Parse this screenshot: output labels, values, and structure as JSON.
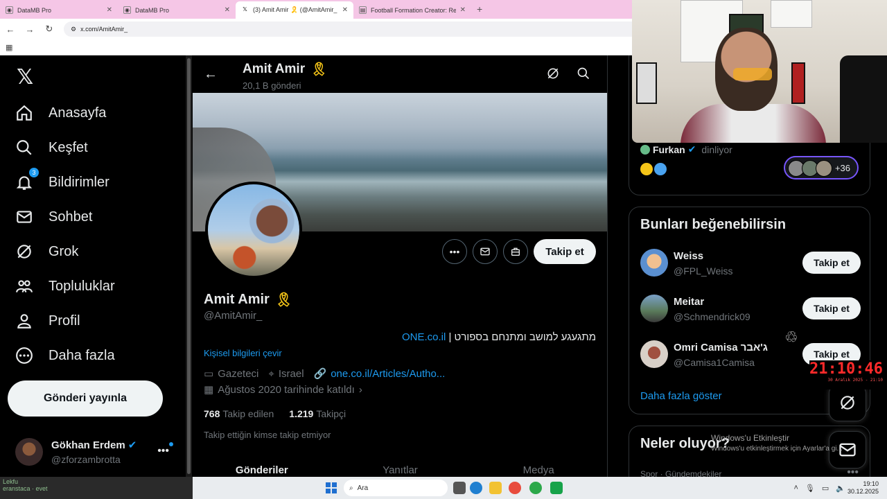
{
  "browser": {
    "tabs": [
      {
        "title": "DataMB Pro",
        "icon": "datamb-icon"
      },
      {
        "title": "DataMB Pro",
        "icon": "datamb-icon"
      },
      {
        "title": "(3) Amit Amir 🎗️ (@AmitAmir_",
        "icon": "x-icon"
      },
      {
        "title": "Football Formation Creator: Re",
        "icon": "doc-icon"
      }
    ],
    "url": "x.com/AmitAmir_"
  },
  "nav": {
    "items": [
      {
        "label": "Anasayfa",
        "icon": "home-icon"
      },
      {
        "label": "Keşfet",
        "icon": "search-icon"
      },
      {
        "label": "Bildirimler",
        "icon": "bell-icon",
        "badge": "3"
      },
      {
        "label": "Sohbet",
        "icon": "mail-icon"
      },
      {
        "label": "Grok",
        "icon": "grok-icon"
      },
      {
        "label": "Topluluklar",
        "icon": "communities-icon"
      },
      {
        "label": "Profil",
        "icon": "profile-icon"
      },
      {
        "label": "Daha fazla",
        "icon": "more-icon"
      }
    ],
    "post_button": "Gönderi yayınla",
    "me": {
      "name": "Gökhan Erdem",
      "handle": "@zforzambrotta"
    }
  },
  "profile": {
    "header_name": "Amit Amir",
    "header_posts": "20,1 B gönderi",
    "name": "Amit Amir",
    "handle": "@AmitAmir_",
    "bio_text": "מתגעגע למושב ומתנחם בספורט |",
    "bio_link": "ONE.co.il",
    "translate": "Kişisel bilgileri çevir",
    "job": "Gazeteci",
    "location": "Israel",
    "website": "one.co.il/Articles/Autho...",
    "joined": "Ağustos 2020 tarihinde katıldı",
    "following_count": "768",
    "following_label": "Takip edilen",
    "followers_count": "1.219",
    "followers_label": "Takipçi",
    "no_mutual": "Takip ettiğin kimse takip etmiyor",
    "follow_button": "Takip et",
    "tabs": [
      "Gönderiler",
      "Yanıtlar",
      "Medya"
    ]
  },
  "space": {
    "listener": "Furkan",
    "listening": "dinliyor",
    "count": "+36"
  },
  "suggest": {
    "title": "Bunları beğenebilirsin",
    "users": [
      {
        "name": "Weiss",
        "handle": "@FPL_Weiss",
        "button": "Takip et"
      },
      {
        "name": "Meitar",
        "handle": "@Schmendrick09",
        "button": "Takip et"
      },
      {
        "name": "Omri Camisa ג'אבר",
        "handle": "@Camisa1Camisa",
        "button": "Takip et"
      }
    ],
    "show_more": "Daha fazla göster"
  },
  "trends": {
    "title": "Neler oluyor?",
    "category": "Spor · Gündemdekiler"
  },
  "overlay": {
    "activate_title": "Windows'u Etkinleştir",
    "activate_sub": "Windows'u etkinleştirmek için Ayarlar'a gi...",
    "clock": "21:10:46",
    "clock_date": "30 Aralık 2025 - 21:10"
  },
  "taskbar": {
    "search": "Ara",
    "time": "19:10",
    "date": "30.12.2025",
    "tray_left_1": "Lekfu",
    "tray_left_2": "eranstaca · evet"
  },
  "colors": {
    "accent": "#1d9bf0",
    "background": "#000000",
    "tab_bar": "#f5c6e6"
  }
}
